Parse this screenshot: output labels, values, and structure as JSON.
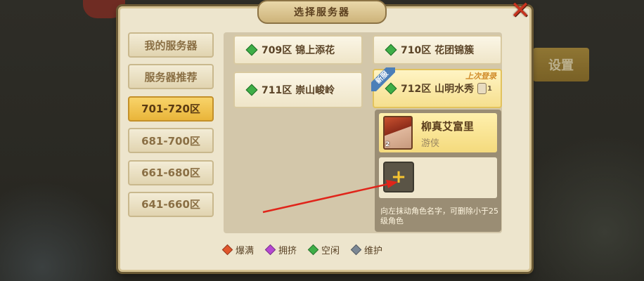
{
  "header": {
    "title": "选择服务器",
    "close_icon": "close-icon"
  },
  "background": {
    "settings_label": "设置"
  },
  "tabs": [
    {
      "label": "我的服务器",
      "active": false
    },
    {
      "label": "服务器推荐",
      "active": false
    },
    {
      "label": "701-720区",
      "active": true
    },
    {
      "label": "681-700区",
      "active": false
    },
    {
      "label": "661-680区",
      "active": false
    },
    {
      "label": "641-660区",
      "active": false
    }
  ],
  "servers": [
    {
      "name": "709区 锦上添花",
      "status": "空闲"
    },
    {
      "name": "710区 花团锦簇",
      "status": "空闲"
    },
    {
      "name": "711区 崇山峻岭",
      "status": "空闲"
    },
    {
      "name": "712区 山明水秀",
      "status": "空闲",
      "badge": "新服",
      "last_login": "上次登录",
      "char_count": "1"
    }
  ],
  "character": {
    "level": "2",
    "name": "柳真艾富里",
    "class": "游侠"
  },
  "add_char": {
    "symbol": "+"
  },
  "hint": "向左抹动角色名字，可删除小于25级角色",
  "legend": [
    {
      "label": "爆满",
      "color": "#e0562c"
    },
    {
      "label": "拥挤",
      "color": "#b548d1"
    },
    {
      "label": "空闲",
      "color": "#3eae47"
    },
    {
      "label": "维护",
      "color": "#7b8794"
    }
  ]
}
